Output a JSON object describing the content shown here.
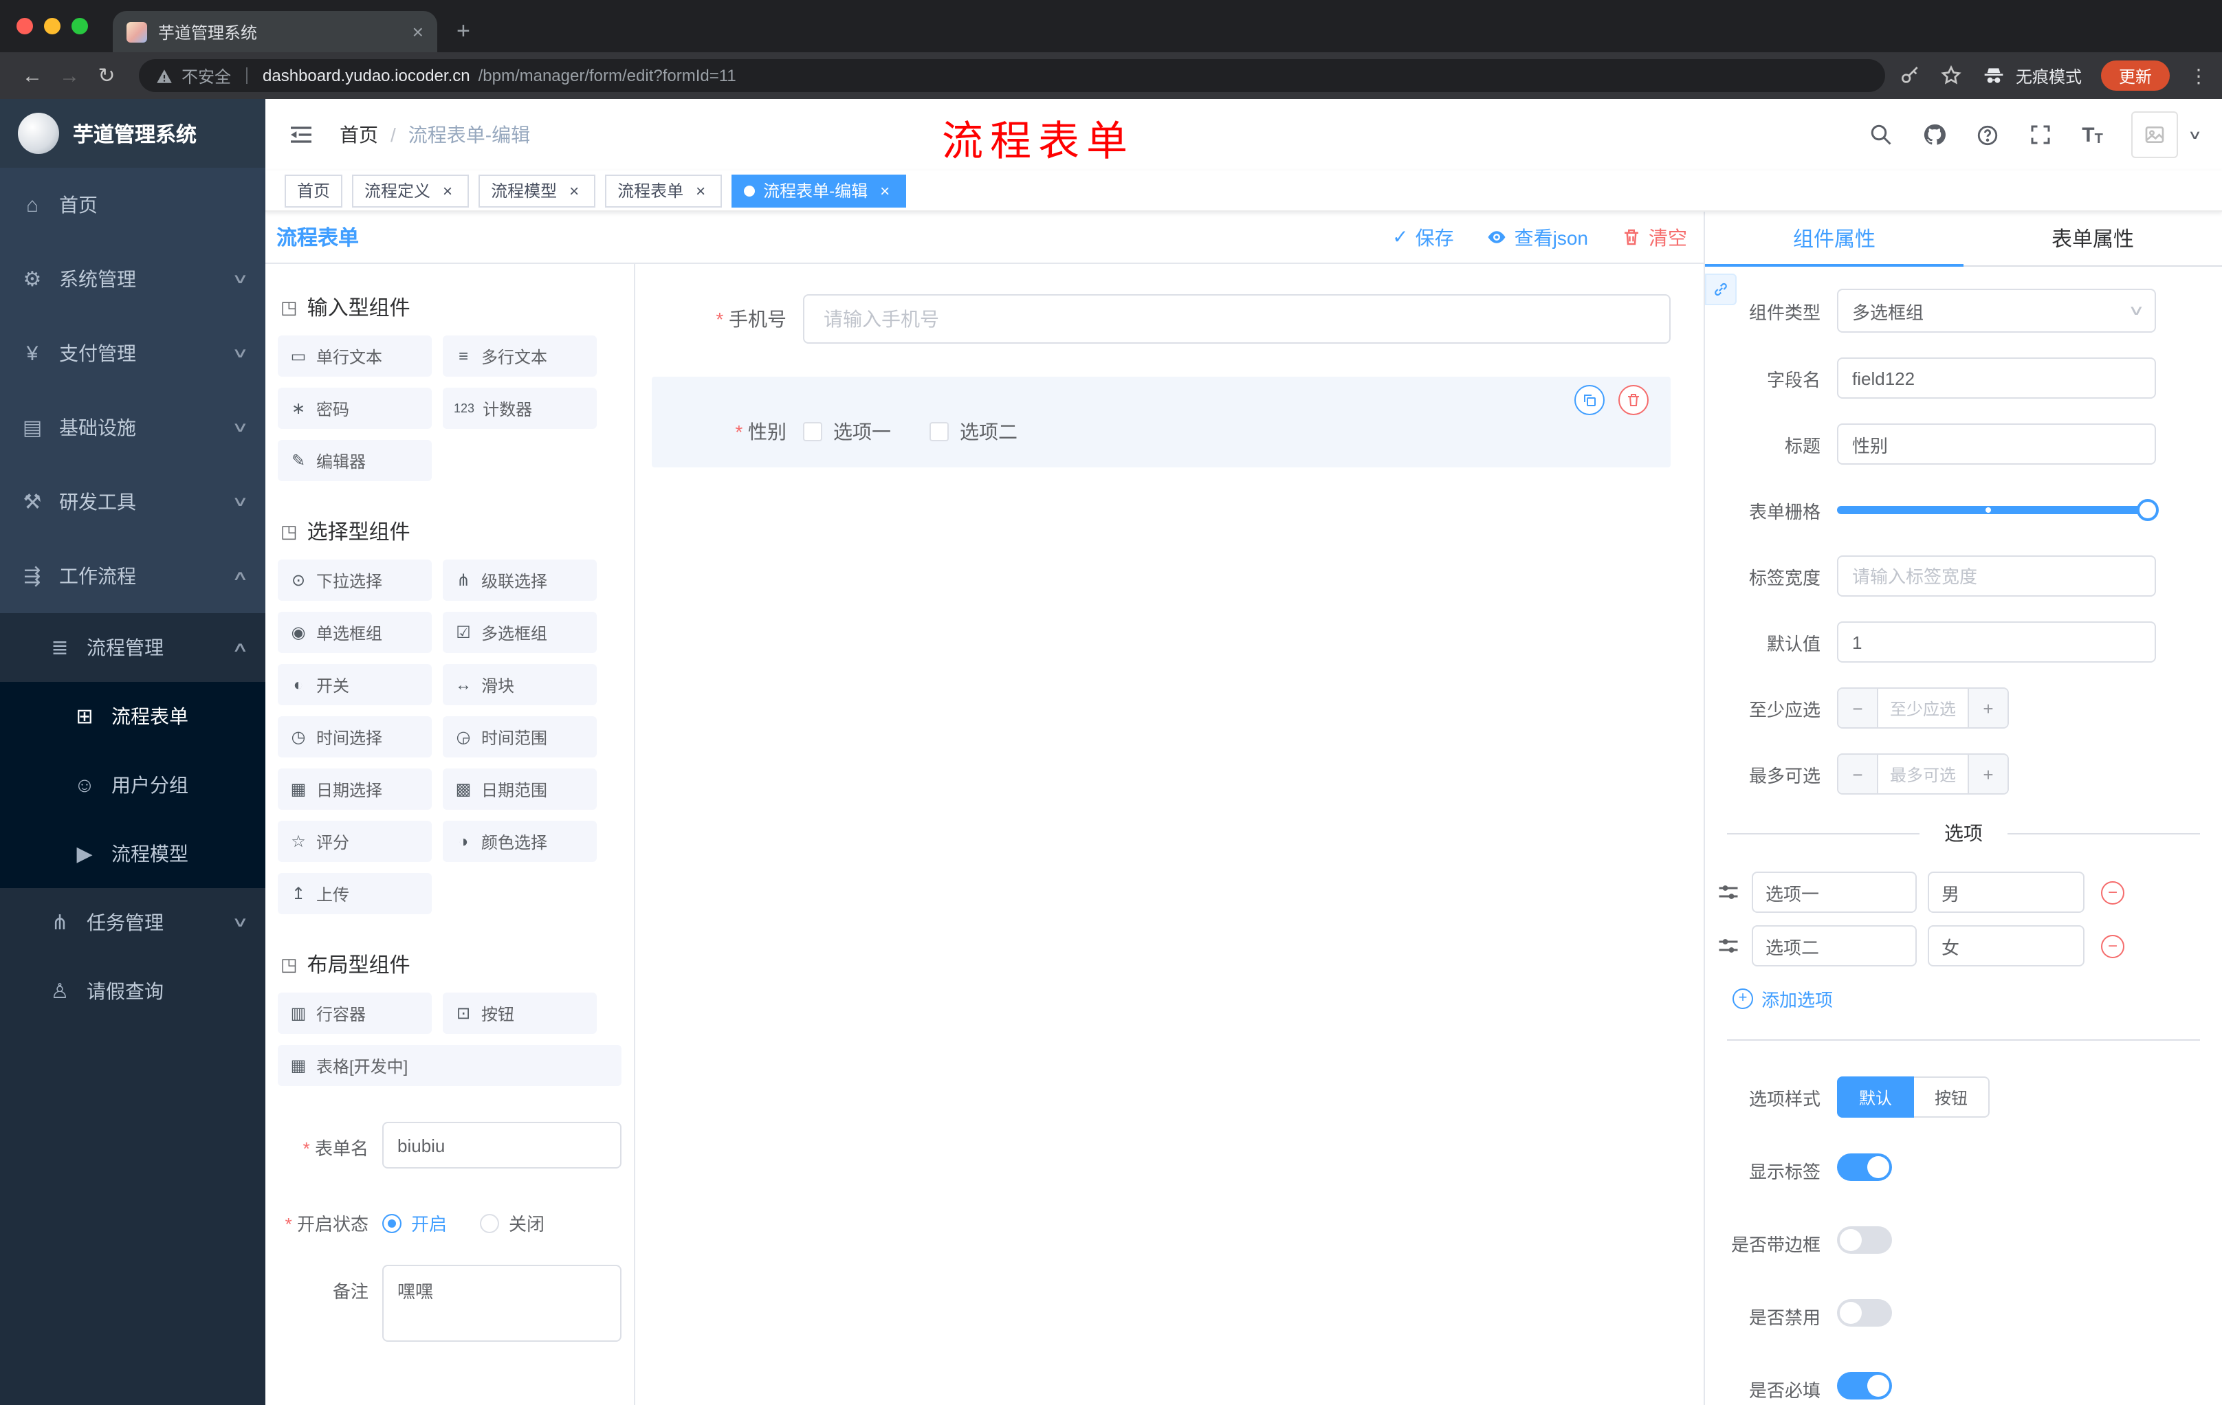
{
  "browser": {
    "tab_title": "芋道管理系统",
    "security_label": "不安全",
    "url_domain": "dashboard.yudao.iocoder.cn",
    "url_path": "/bpm/manager/form/edit?formId=11",
    "incognito_label": "无痕模式",
    "update_label": "更新"
  },
  "sidebar": {
    "logo_title": "芋道管理系统",
    "items": [
      {
        "label": "首页"
      },
      {
        "label": "系统管理"
      },
      {
        "label": "支付管理"
      },
      {
        "label": "基础设施"
      },
      {
        "label": "研发工具"
      },
      {
        "label": "工作流程"
      },
      {
        "label": "流程管理"
      },
      {
        "label": "流程表单"
      },
      {
        "label": "用户分组"
      },
      {
        "label": "流程模型"
      },
      {
        "label": "任务管理"
      },
      {
        "label": "请假查询"
      }
    ]
  },
  "header": {
    "breadcrumb_home": "首页",
    "breadcrumb_current": "流程表单-编辑",
    "annotation": "流程表单"
  },
  "tags": [
    {
      "label": "首页"
    },
    {
      "label": "流程定义"
    },
    {
      "label": "流程模型"
    },
    {
      "label": "流程表单"
    },
    {
      "label": "流程表单-编辑"
    }
  ],
  "designer": {
    "panel_title": "流程表单",
    "actions": {
      "save": "保存",
      "view_json": "查看json",
      "clear": "清空"
    },
    "palette": {
      "sections": [
        {
          "title": "输入型组件",
          "items": [
            "单行文本",
            "多行文本",
            "密码",
            "计数器",
            "编辑器"
          ]
        },
        {
          "title": "选择型组件",
          "items": [
            "下拉选择",
            "级联选择",
            "单选框组",
            "多选框组",
            "开关",
            "滑块",
            "时间选择",
            "时间范围",
            "日期选择",
            "日期范围",
            "评分",
            "颜色选择",
            "上传"
          ]
        },
        {
          "title": "布局型组件",
          "items": [
            "行容器",
            "按钮",
            "表格[开发中]"
          ]
        }
      ]
    },
    "config": {
      "form_name_label": "表单名",
      "form_name_value": "biubiu",
      "status_label": "开启状态",
      "status_on": "开启",
      "status_off": "关闭",
      "remark_label": "备注",
      "remark_value": "嘿嘿"
    },
    "canvas": {
      "phone_label": "手机号",
      "phone_placeholder": "请输入手机号",
      "gender_label": "性别",
      "gender_opt1": "选项一",
      "gender_opt2": "选项二"
    }
  },
  "properties": {
    "tab_component": "组件属性",
    "tab_form": "表单属性",
    "component_type": {
      "label": "组件类型",
      "value": "多选框组"
    },
    "field_name": {
      "label": "字段名",
      "value": "field122"
    },
    "title": {
      "label": "标题",
      "value": "性别"
    },
    "grid": {
      "label": "表单栅格"
    },
    "label_width": {
      "label": "标签宽度",
      "placeholder": "请输入标签宽度"
    },
    "default_value": {
      "label": "默认值",
      "value": "1"
    },
    "min_select": {
      "label": "至少应选",
      "placeholder": "至少应选"
    },
    "max_select": {
      "label": "最多可选",
      "placeholder": "最多可选"
    },
    "options_title": "选项",
    "options": [
      {
        "name": "选项一",
        "value": "男"
      },
      {
        "name": "选项二",
        "value": "女"
      }
    ],
    "add_option": "添加选项",
    "option_style": {
      "label": "选项样式",
      "opt_default": "默认",
      "opt_button": "按钮",
      "selected": "默认"
    },
    "show_label": {
      "label": "显示标签",
      "on": true
    },
    "border": {
      "label": "是否带边框",
      "on": false
    },
    "disabled": {
      "label": "是否禁用",
      "on": false
    },
    "required_switch": {
      "label": "是否必填",
      "on": true
    }
  },
  "colors": {
    "accent": "#409eff",
    "danger": "#f56c6c",
    "annotation_red": "#fe0000",
    "sidebar_bg": "#304156",
    "sidebar_submenu_bg": "#1f2d3d",
    "sidebar_deep_bg": "#001528",
    "update_button_bg": "#d94f2e"
  },
  "icons": {
    "glyphs": {
      "close": "×",
      "plus": "+",
      "minus": "−",
      "kebab": "⋮",
      "back": "←",
      "forward": "→",
      "reload": "↻",
      "chevron_down": "∨",
      "chevron_up": "∧",
      "home": "⌂",
      "gear": "⚙",
      "yen": "¥",
      "infra": "▤",
      "tools": "⚒",
      "workflow": "⇶",
      "process": "≣",
      "form": "⊞",
      "users": "☺",
      "model": "▶",
      "task": "⋔",
      "leave": "♙",
      "section": "◳",
      "single_line": "▭",
      "multi_line": "≡",
      "password": "∗",
      "counter": "123",
      "editor": "✎",
      "select": "⊙",
      "cascader": "⋔",
      "radio": "◉",
      "checkbox": "☑",
      "switch": "◐",
      "slider": "↔",
      "time": "◷",
      "time_range": "◶",
      "date": "▦",
      "date_range": "▩",
      "rate": "☆",
      "color": "◑",
      "upload": "↥",
      "row": "▥",
      "button": "⊡",
      "table": "▦",
      "check": "✓",
      "font_large": "T",
      "font_small": "T"
    }
  }
}
